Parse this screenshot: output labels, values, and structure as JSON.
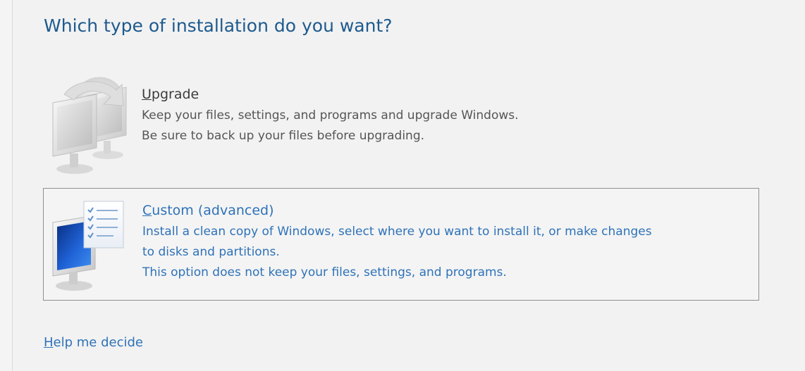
{
  "window": {
    "title": "Which type of installation do you want?"
  },
  "options": [
    {
      "id": "upgrade",
      "label": "Upgrade",
      "lines": [
        "Keep your files, settings, and programs and upgrade Windows.",
        "Be sure to back up your files before upgrading."
      ],
      "icon": "upgrade-computers-icon",
      "state": "disabled"
    },
    {
      "id": "custom",
      "label": "Custom (advanced)",
      "lines": [
        "Install a clean copy of Windows, select where you want to install it, or make changes",
        "to disks and partitions.",
        "This option does not keep your files, settings, and programs."
      ],
      "icon": "custom-install-computer-icon",
      "state": "hover"
    }
  ],
  "help": {
    "label": "Help me decide"
  },
  "colors": {
    "title": "#1e5a8e",
    "link": "#2e72b8",
    "disabled_text": "#555555",
    "background": "#f2f2f2",
    "hover_border": "#8e8e8e"
  }
}
